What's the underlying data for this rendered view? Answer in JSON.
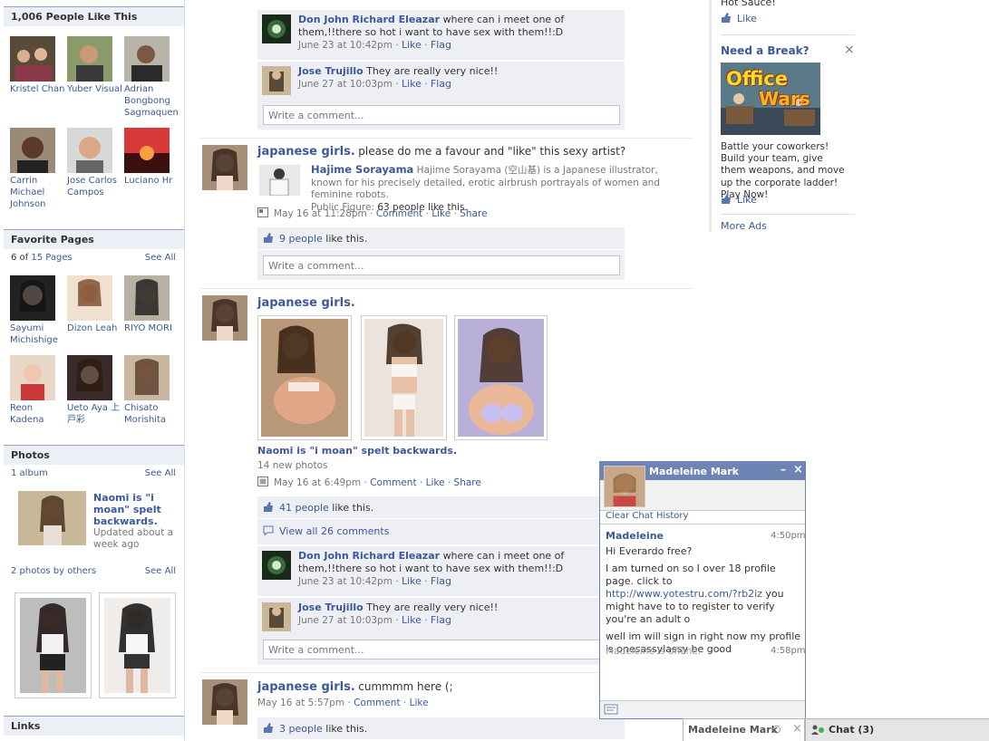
{
  "left": {
    "likes_header": "1,006 People Like This",
    "friends": [
      {
        "name": "Kristel Chan"
      },
      {
        "name": "Yuber Visual"
      },
      {
        "name": "Adrian Bongbong Sagmaquen"
      },
      {
        "name": "Carrin Michael Johnson"
      },
      {
        "name": "Jose Carlos Campos"
      },
      {
        "name": "Luciano Hr"
      }
    ],
    "fav_header": "Favorite Pages",
    "fav_count_prefix": "6 of ",
    "fav_count_link": "15 Pages",
    "see_all": "See All",
    "fav_pages": [
      {
        "name": "Sayumi Michishige"
      },
      {
        "name": "Dizon Leah"
      },
      {
        "name": "RIYO MORI"
      },
      {
        "name": "Reon Kadena"
      },
      {
        "name": "Ueto Aya 上戸彩"
      },
      {
        "name": "Chisato Morishita"
      }
    ],
    "photos_header": "Photos",
    "album_count": "1 album",
    "album_title": "Naomi is \"i moan\" spelt backwards.",
    "album_updated": "Updated about a week ago",
    "photos_by_others": "2 photos by others",
    "links_header": "Links"
  },
  "feed": {
    "comment_a": {
      "name": "Don John Richard Eleazar",
      "text": "where can i meet one of them,!!there so hot i want to have sex with them!!:D",
      "time": "June 23 at 10:42pm"
    },
    "comment_b": {
      "name": "Jose Trujillo",
      "text": "They are really very nice!!",
      "time": "June 27 at 10:03pm"
    },
    "like": "Like",
    "flag": "Flag",
    "comment": "Comment",
    "share": "Share",
    "write_comment": "Write a comment...",
    "sep": " · ",
    "page_name": "japanese girls.",
    "story1": {
      "message": "please do me a favour and \"like\" this sexy artist?",
      "attach_title": "Hajime Sorayama",
      "attach_desc": "Hajime Sorayama (空山基) is a Japanese illustrator, known for his precisely detailed, erotic airbrush portrayals of women and feminine robots.",
      "attach_label": "Public Figure:",
      "attach_likes": "63 people like this.",
      "time": "May 16 at 11:28pm",
      "likes_link": "9 people",
      "likes_rest": "like this."
    },
    "story2": {
      "album_link": "Naomi is \"i moan\" spelt backwards.",
      "new_photos": "14 new photos",
      "time": "May 16 at 6:49pm",
      "likes_link": "41 people",
      "likes_rest": "like this.",
      "view_all": "View all 26 comments"
    },
    "story3": {
      "message": "cummmm here (;",
      "time": "May 16 at 5:57pm",
      "likes_link": "3 people",
      "likes_rest": "like this."
    }
  },
  "ads": {
    "hot_sauce": "Hot Sauce!",
    "like": "Like",
    "title": "Need a Break?",
    "close": "×",
    "logo_line1": "Office",
    "logo_line2": "Wars",
    "body": "Battle your coworkers! Build your team, give them weapons, and move up the corporate ladder! Play Now!",
    "more_ads": "More Ads"
  },
  "chat": {
    "title": "Madeleine Mark",
    "clear": "Clear Chat History",
    "sender": "Madeleine",
    "time1": "4:50pm",
    "msg1": "Hi Everardo free?",
    "msg2_pre": "I am turned on so I over 18 profile page. click to ",
    "msg2_link": "http://www.yotestru.com/?rb2iz",
    "msg2_post": " you might have to to register to verify you're an adult o",
    "msg3": "well im will sign in right now my profile is onesassylassy be good",
    "offline": "Madeleine is offline.",
    "time2": "4:58pm",
    "bar_name": "Madeleine Mark",
    "bar_chat": "Chat (3)"
  },
  "colors": {
    "brand": "#3b5998",
    "chat_header": "#6d84b4",
    "ufi": "#edeff4"
  }
}
